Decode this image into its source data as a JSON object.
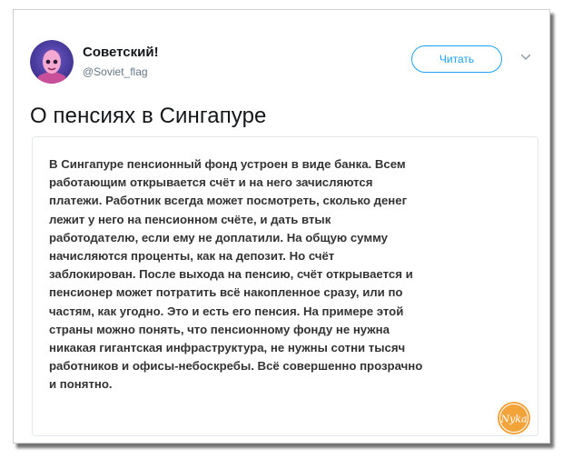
{
  "tweet": {
    "author_name": "Советский!",
    "author_handle": "@Soviet_flag",
    "follow_label": "Читать",
    "title": "О пенсиях в Сингапуре",
    "body_lines": [
      "В Сингапуре пенсионный фонд устроен в виде банка. Всем",
      "работающим открывается счёт и на него зачисляются",
      "платежи. Работник всегда может посмотреть, сколько денег",
      "лежит у него на пенсионном счёте, и дать втык",
      "работодателю, если ему не доплатили. На общую сумму",
      "начисляются проценты, как на депозит. Но счёт",
      "заблокирован. После выхода на пенсию, счёт открывается и",
      "пенсионер может потратить всё накопленное сразу, или по",
      "частям, как угодно. Это и есть его пенсия. На примере этой",
      "страны можно понять, что пенсионному фонду не нужна",
      "никакая гигантская инфраструктура, не нужны сотни тысяч",
      "работников и офисы-небоскребы. Всё совершенно прозрачно",
      "и понятно."
    ]
  },
  "watermark": {
    "text": "Nyka"
  },
  "icons": {
    "avatar": "avatar-pink-head",
    "chevron": "chevron-down-icon",
    "watermark": "nyka-logo"
  },
  "colors": {
    "accent": "#1da1f2",
    "text": "#14171a",
    "muted": "#657786",
    "watermark": "#f2a33a"
  }
}
